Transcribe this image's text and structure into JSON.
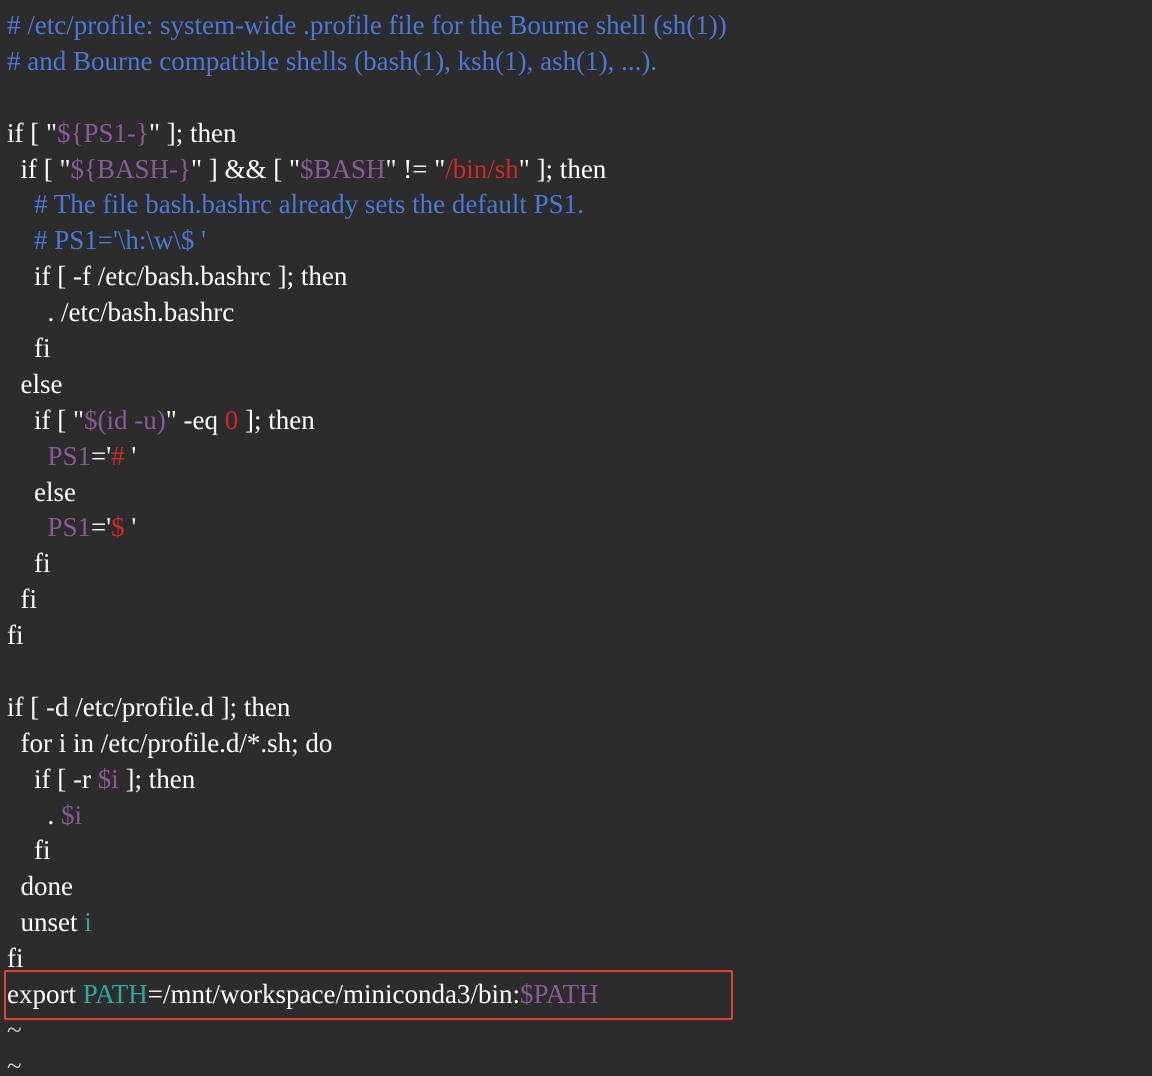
{
  "editor": {
    "highlight_color": "#e2452e",
    "colors": {
      "background": "#2c2c2c",
      "text": "#ffffff",
      "comment": "#4a78d6",
      "variable": "#8a5a98",
      "string": "#d02727",
      "identifier": "#2fa6a0"
    },
    "lines": [
      [
        {
          "t": "# /etc/profile: system-wide .profile file for the Bourne shell (sh(1))",
          "c": "comment"
        }
      ],
      [
        {
          "t": "# and Bourne compatible shells (bash(1), ksh(1), ash(1), ...).",
          "c": "comment"
        }
      ],
      [],
      [
        {
          "t": "if [ \"",
          "c": "white"
        },
        {
          "t": "${PS1-}",
          "c": "purple"
        },
        {
          "t": "\" ]; then",
          "c": "white"
        }
      ],
      [
        {
          "t": "  if [ \"",
          "c": "white"
        },
        {
          "t": "${BASH-}",
          "c": "purple"
        },
        {
          "t": "\" ] && [ \"",
          "c": "white"
        },
        {
          "t": "$BASH",
          "c": "purple"
        },
        {
          "t": "\" != \"",
          "c": "white"
        },
        {
          "t": "/bin/sh",
          "c": "red"
        },
        {
          "t": "\" ]; then",
          "c": "white"
        }
      ],
      [
        {
          "t": "    # The file bash.bashrc already sets the default PS1.",
          "c": "comment"
        }
      ],
      [
        {
          "t": "    # PS1='\\h:\\w\\$ '",
          "c": "comment"
        }
      ],
      [
        {
          "t": "    if [ -f /etc/bash.bashrc ]; then",
          "c": "white"
        }
      ],
      [
        {
          "t": "      . /etc/bash.bashrc",
          "c": "white"
        }
      ],
      [
        {
          "t": "    fi",
          "c": "white"
        }
      ],
      [
        {
          "t": "  else",
          "c": "white"
        }
      ],
      [
        {
          "t": "    if [ \"",
          "c": "white"
        },
        {
          "t": "$(id -u)",
          "c": "purple"
        },
        {
          "t": "\" -eq ",
          "c": "white"
        },
        {
          "t": "0",
          "c": "red"
        },
        {
          "t": " ]; then",
          "c": "white"
        }
      ],
      [
        {
          "t": "      ",
          "c": "white"
        },
        {
          "t": "PS1",
          "c": "purple"
        },
        {
          "t": "='",
          "c": "white"
        },
        {
          "t": "# ",
          "c": "red"
        },
        {
          "t": "'",
          "c": "white"
        }
      ],
      [
        {
          "t": "    else",
          "c": "white"
        }
      ],
      [
        {
          "t": "      ",
          "c": "white"
        },
        {
          "t": "PS1",
          "c": "purple"
        },
        {
          "t": "='",
          "c": "white"
        },
        {
          "t": "$ ",
          "c": "red"
        },
        {
          "t": "'",
          "c": "white"
        }
      ],
      [
        {
          "t": "    fi",
          "c": "white"
        }
      ],
      [
        {
          "t": "  fi",
          "c": "white"
        }
      ],
      [
        {
          "t": "fi",
          "c": "white"
        }
      ],
      [],
      [
        {
          "t": "if [ -d /etc/profile.d ]; then",
          "c": "white"
        }
      ],
      [
        {
          "t": "  for i in /etc/profile.d/*.sh; do",
          "c": "white"
        }
      ],
      [
        {
          "t": "    if [ -r ",
          "c": "white"
        },
        {
          "t": "$i",
          "c": "purple"
        },
        {
          "t": " ]; then",
          "c": "white"
        }
      ],
      [
        {
          "t": "      . ",
          "c": "white"
        },
        {
          "t": "$i",
          "c": "purple"
        }
      ],
      [
        {
          "t": "    fi",
          "c": "white"
        }
      ],
      [
        {
          "t": "  done",
          "c": "white"
        }
      ],
      [
        {
          "t": "  unset ",
          "c": "white"
        },
        {
          "t": "i",
          "c": "teal"
        }
      ],
      [
        {
          "t": "fi",
          "c": "white"
        }
      ],
      [
        {
          "t": "export ",
          "c": "white"
        },
        {
          "t": "PATH",
          "c": "teal"
        },
        {
          "t": "=/mnt/workspace/miniconda3/bin:",
          "c": "white"
        },
        {
          "t": "$PATH",
          "c": "purple"
        }
      ],
      [
        {
          "t": "~",
          "c": "tilde"
        }
      ],
      [
        {
          "t": "~",
          "c": "tilde"
        }
      ]
    ]
  }
}
